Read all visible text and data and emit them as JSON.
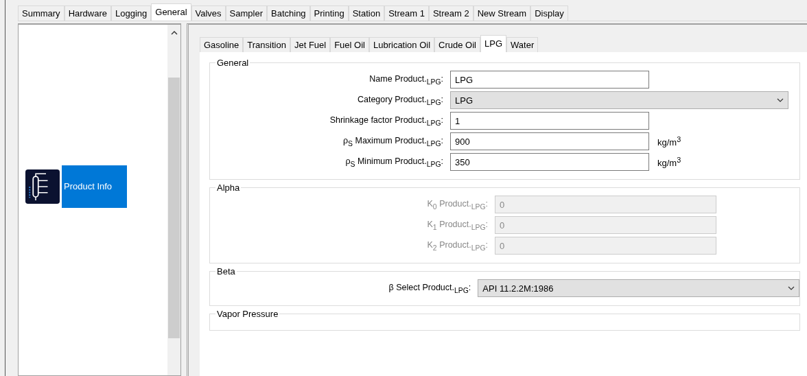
{
  "main_tabs": [
    {
      "label": "Summary",
      "selected": false
    },
    {
      "label": "Hardware",
      "selected": false
    },
    {
      "label": "Logging",
      "selected": false
    },
    {
      "label": "General",
      "selected": true
    },
    {
      "label": "Valves",
      "selected": false
    },
    {
      "label": "Sampler",
      "selected": false
    },
    {
      "label": "Batching",
      "selected": false
    },
    {
      "label": "Printing",
      "selected": false
    },
    {
      "label": "Station",
      "selected": false
    },
    {
      "label": "Stream 1",
      "selected": false
    },
    {
      "label": "Stream 2",
      "selected": false
    },
    {
      "label": "New Stream",
      "selected": false
    },
    {
      "label": "Display",
      "selected": false
    }
  ],
  "sidebar": {
    "items": [
      {
        "label": "Product Info",
        "selected": true
      }
    ]
  },
  "product_tabs": [
    {
      "label": "Gasoline",
      "selected": false
    },
    {
      "label": "Transition",
      "selected": false
    },
    {
      "label": "Jet Fuel",
      "selected": false
    },
    {
      "label": "Fuel Oil",
      "selected": false
    },
    {
      "label": "Lubrication Oil",
      "selected": false
    },
    {
      "label": "Crude Oil",
      "selected": false
    },
    {
      "label": "LPG",
      "selected": true
    },
    {
      "label": "Water",
      "selected": false
    }
  ],
  "sections": [
    {
      "title": "General",
      "fields": [
        {
          "label": "Name Product.$_{LPG}$:",
          "kind": "text",
          "value": "LPG",
          "disabled": false
        },
        {
          "label": "Category Product.$_{LPG}$:",
          "kind": "combo",
          "value": "LPG",
          "disabled": false
        },
        {
          "label": "Shrinkage factor Product.$_{LPG}$:",
          "kind": "text",
          "value": "1",
          "disabled": false
        },
        {
          "label": "ρ$_{S}$ Maximum Product.$_{LPG}$:",
          "kind": "text",
          "value": "900",
          "disabled": false,
          "unit": "kg/m$^{3}$"
        },
        {
          "label": "ρ$_{S}$ Minimum Product.$_{LPG}$:",
          "kind": "text",
          "value": "350",
          "disabled": false,
          "unit": "kg/m$^{3}$"
        }
      ]
    },
    {
      "title": "Alpha",
      "fields": [
        {
          "label": "K$_{0}$ Product.$_{LPG}$:",
          "kind": "text",
          "value": "0",
          "disabled": true
        },
        {
          "label": "K$_{1}$ Product.$_{LPG}$:",
          "kind": "text",
          "value": "0",
          "disabled": true
        },
        {
          "label": "K$_{2}$ Product.$_{LPG}$:",
          "kind": "text",
          "value": "0",
          "disabled": true
        }
      ]
    },
    {
      "title": "Beta",
      "fields": [
        {
          "label": "β Select Product.$_{LPG}$:",
          "kind": "combo",
          "value": "API 11.2.2M:1986",
          "disabled": false
        }
      ]
    },
    {
      "title": "Vapor Pressure"
    }
  ]
}
